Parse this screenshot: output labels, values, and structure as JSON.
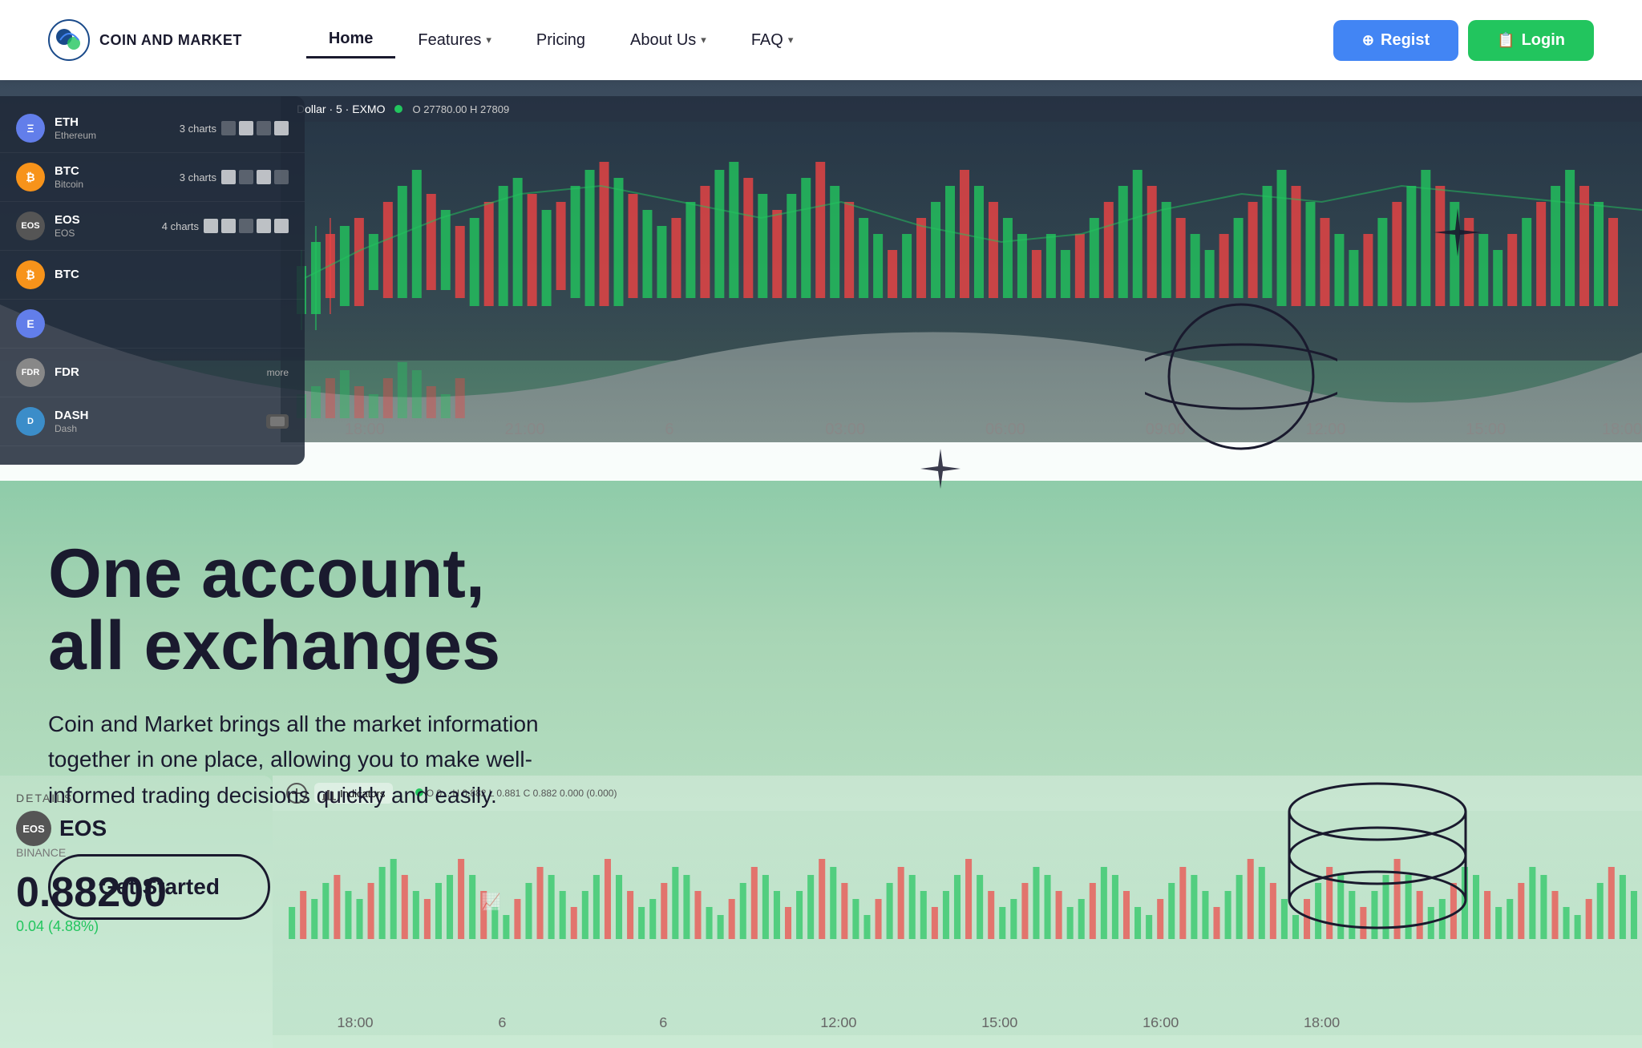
{
  "navbar": {
    "logo_text": "COIN AND MARKET",
    "nav_items": [
      {
        "label": "Home",
        "active": true,
        "has_dropdown": false
      },
      {
        "label": "Features",
        "active": false,
        "has_dropdown": true
      },
      {
        "label": "Pricing",
        "active": false,
        "has_dropdown": false
      },
      {
        "label": "About Us",
        "active": false,
        "has_dropdown": true
      },
      {
        "label": "FAQ",
        "active": false,
        "has_dropdown": true
      }
    ],
    "register_label": "Regist",
    "login_label": "Login"
  },
  "hero": {
    "title_line1": "One account,",
    "title_line2": "all exchanges",
    "description": "Coin and Market brings all the market information together in one place, allowing you to make well-informed trading decisions quickly and easily.",
    "cta_label": "Get Started"
  },
  "chart_panel": {
    "coins": [
      {
        "symbol": "ETH",
        "name": "Ethereum",
        "coin_class": "coin-eth",
        "layouts": "3 charts"
      },
      {
        "symbol": "BTC",
        "name": "Bitcoin",
        "coin_class": "coin-btc",
        "layouts": "3 charts"
      },
      {
        "symbol": "EOS",
        "name": "EOS",
        "coin_class": "coin-eos",
        "layouts": "4 charts"
      },
      {
        "symbol": "FDR",
        "name": "FDR",
        "coin_class": "coin-fdr",
        "layouts": ""
      },
      {
        "symbol": "DASH",
        "name": "Dash",
        "coin_class": "coin-dash",
        "layouts": ""
      }
    ],
    "header_text": "Dollar · 5 · EXMO",
    "ohlc": "O 27780.00  H 27809"
  },
  "details": {
    "section_label": "DETAILS",
    "coin": "EOS",
    "exchange": "BINANCE",
    "price": "0.88200",
    "change": "0.04 (4.88%)"
  },
  "lower_chart": {
    "ohlc_text": "O 0... H 0.882 L 0.881 C 0.882 0.000 (0.000)",
    "indicators_label": "Indicators"
  },
  "colors": {
    "accent_blue": "#4285f4",
    "accent_green": "#22c55e",
    "dark_navy": "#1a1a2e",
    "chart_bg": "#3a4a5c",
    "hero_green": "#7bc4a0"
  }
}
